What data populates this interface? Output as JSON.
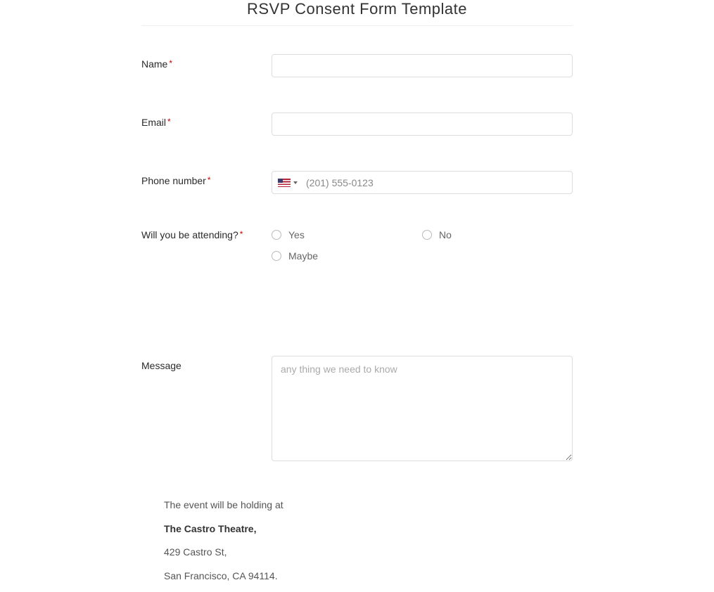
{
  "title": "RSVP Consent Form Template",
  "fields": {
    "name": {
      "label": "Name",
      "required": true,
      "value": ""
    },
    "email": {
      "label": "Email",
      "required": true,
      "value": ""
    },
    "phone": {
      "label": "Phone number",
      "required": true,
      "placeholder": "(201) 555-0123",
      "value": ""
    },
    "attending": {
      "label": "Will you be attending?",
      "required": true,
      "options": [
        "Yes",
        "No",
        "Maybe"
      ],
      "selected": null
    },
    "message": {
      "label": "Message",
      "required": false,
      "placeholder": "any thing we need to know",
      "value": ""
    }
  },
  "event": {
    "intro": "The event will be holding at",
    "venue": "The Castro Theatre,",
    "street": "429 Castro St,",
    "city": "San Francisco, CA 94114."
  }
}
